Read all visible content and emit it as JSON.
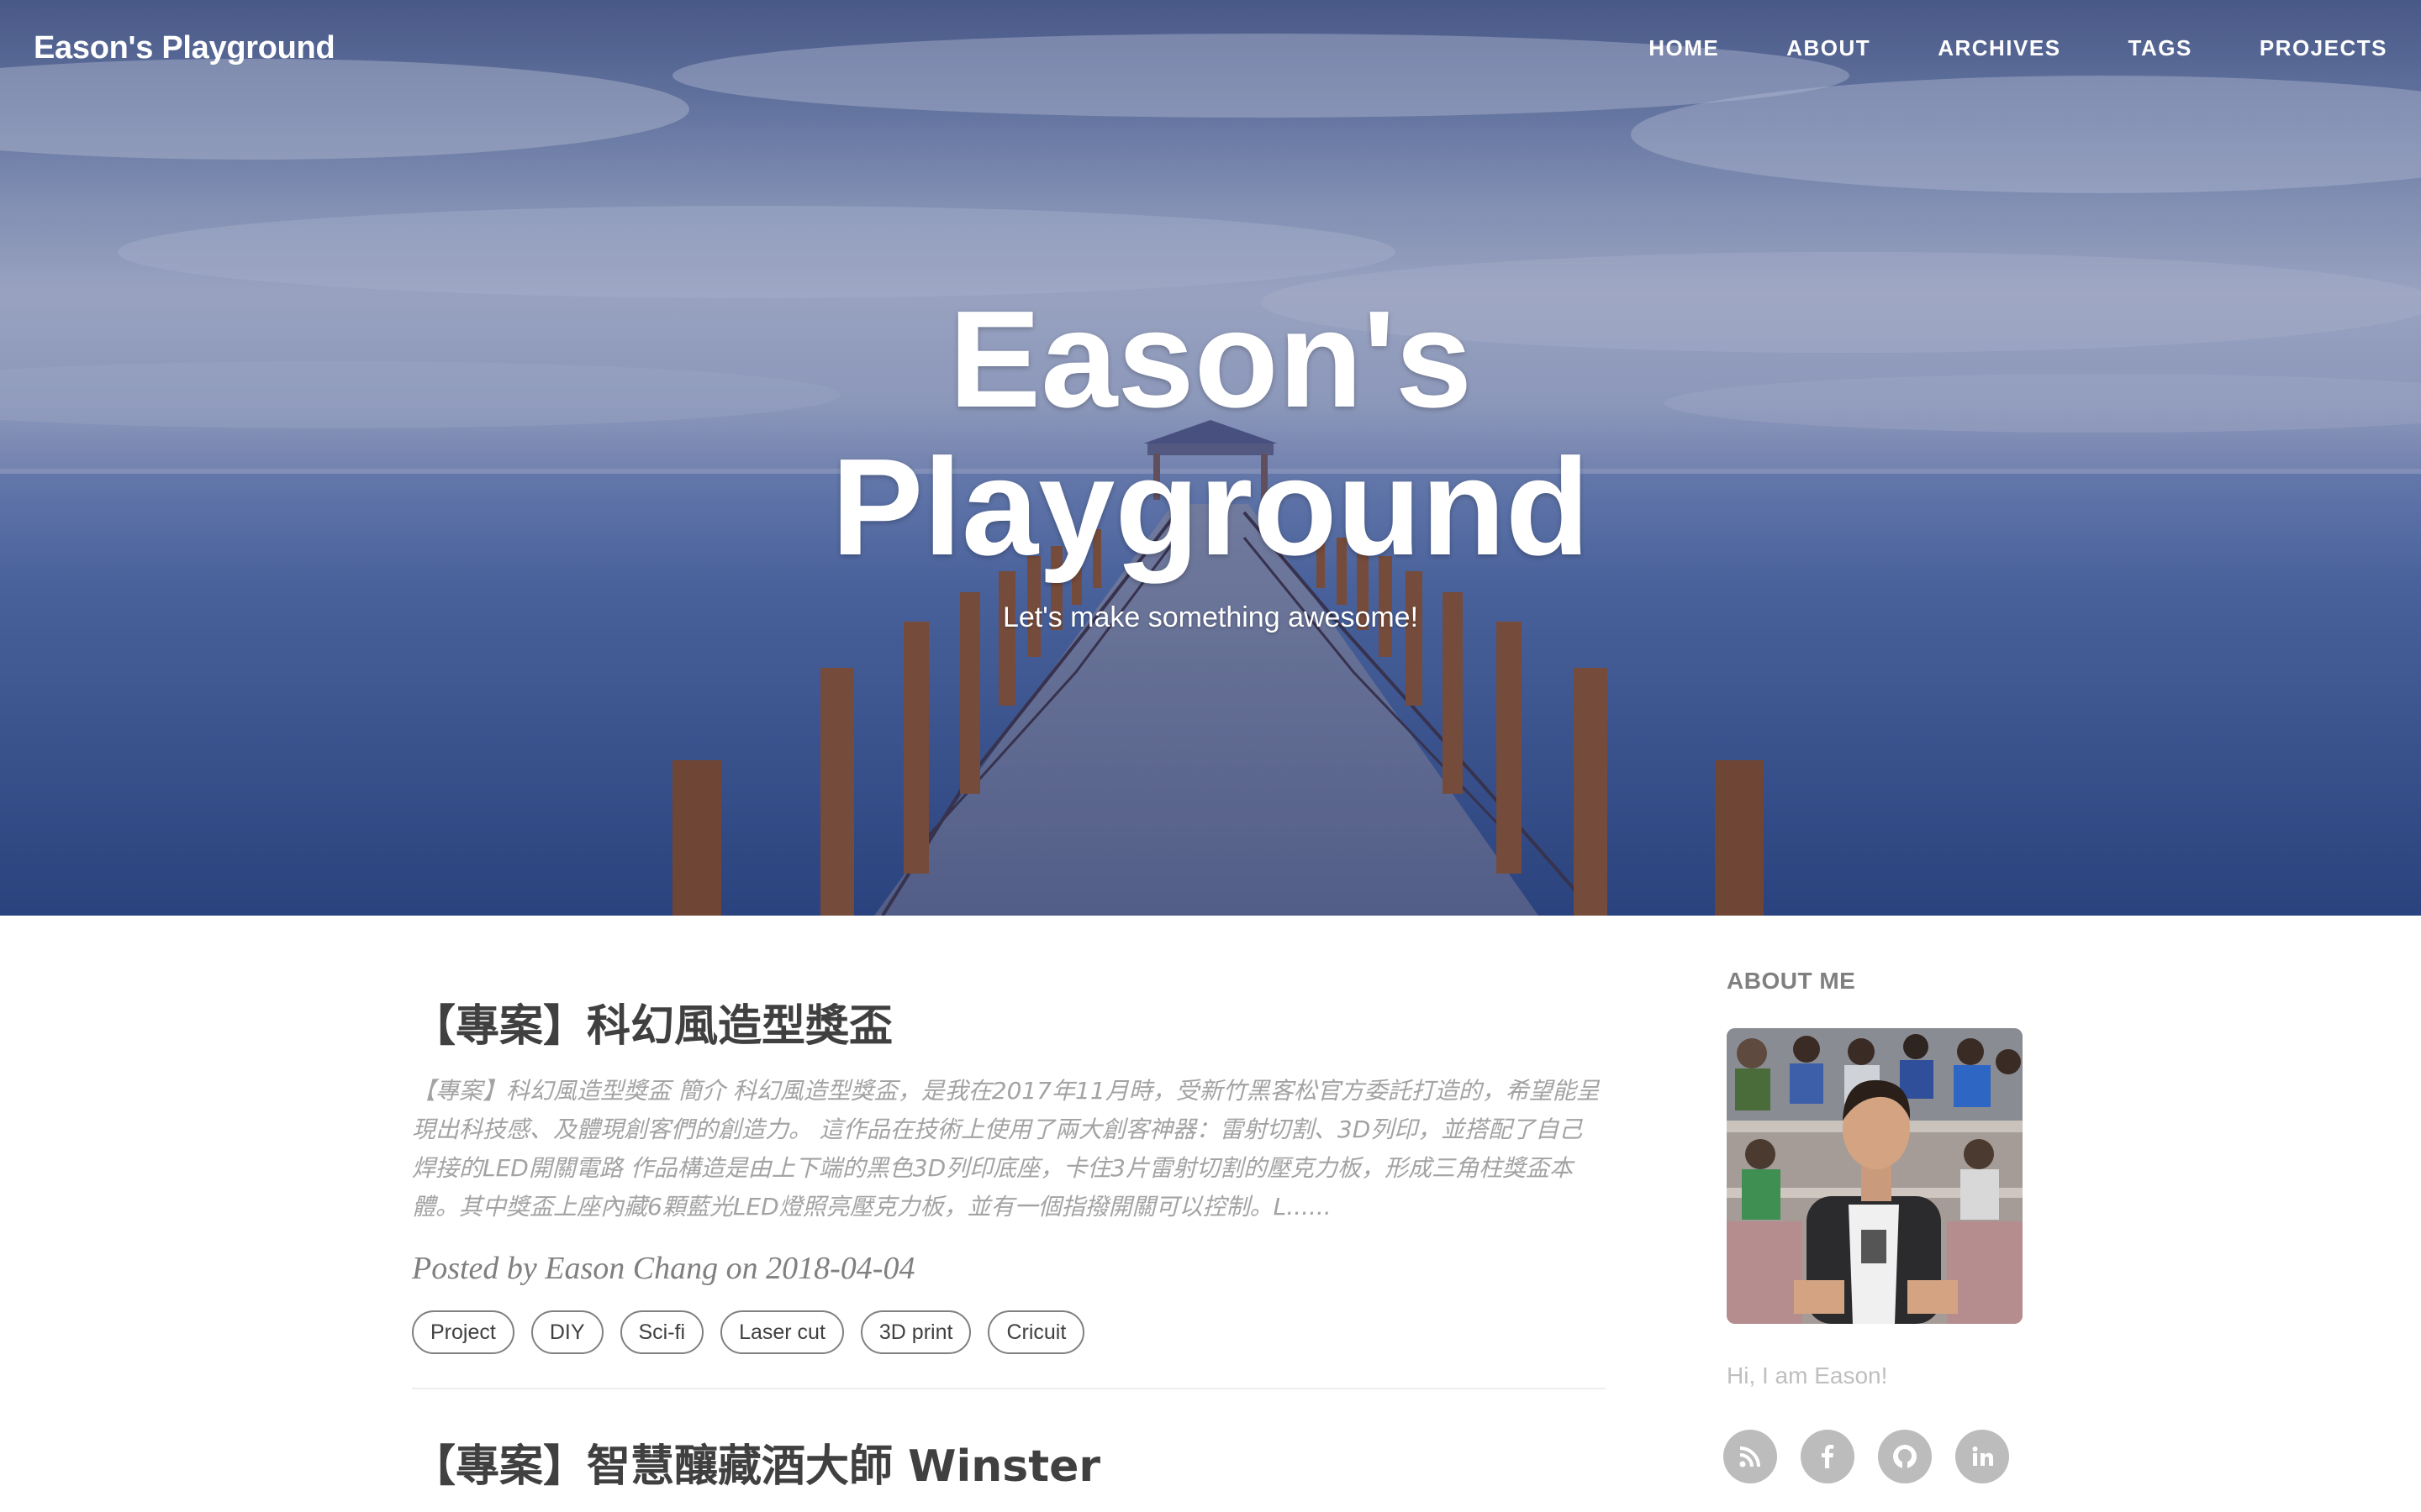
{
  "nav": {
    "brand": "Eason's Playground",
    "links": [
      "HOME",
      "ABOUT",
      "ARCHIVES",
      "TAGS",
      "PROJECTS"
    ]
  },
  "hero": {
    "title": "Eason's Playground",
    "subtitle": "Let's make something awesome!"
  },
  "posts": [
    {
      "title": "【專案】科幻風造型獎盃",
      "excerpt": "【專案】科幻風造型獎盃 簡介 科幻風造型獎盃，是我在2017年11月時，受新竹黑客松官方委託打造的，希望能呈現出科技感、及體現創客們的創造力。 這作品在技術上使用了兩大創客神器：雷射切割、3D列印，並搭配了自己焊接的LED開關電路 作品構造是由上下端的黑色3D列印底座，卡住3片雷射切割的壓克力板，形成三角柱獎盃本體。其中獎盃上座內藏6顆藍光LED燈照亮壓克力板，並有一個指撥開關可以控制。L......",
      "meta": "Posted by Eason Chang on 2018-04-04",
      "tags": [
        "Project",
        "DIY",
        "Sci-fi",
        "Laser cut",
        "3D print",
        "Cricuit"
      ]
    },
    {
      "title": "【專案】智慧釀藏酒大師 Winster"
    }
  ],
  "sidebar": {
    "heading": "ABOUT ME",
    "greeting": "Hi, I am Eason!",
    "social": [
      "rss-icon",
      "facebook-icon",
      "github-icon",
      "linkedin-icon"
    ]
  },
  "colors": {
    "heading": "#404040",
    "excerpt": "#a3a3a3",
    "meta": "#808080",
    "social_bg": "#bcbcbc"
  }
}
